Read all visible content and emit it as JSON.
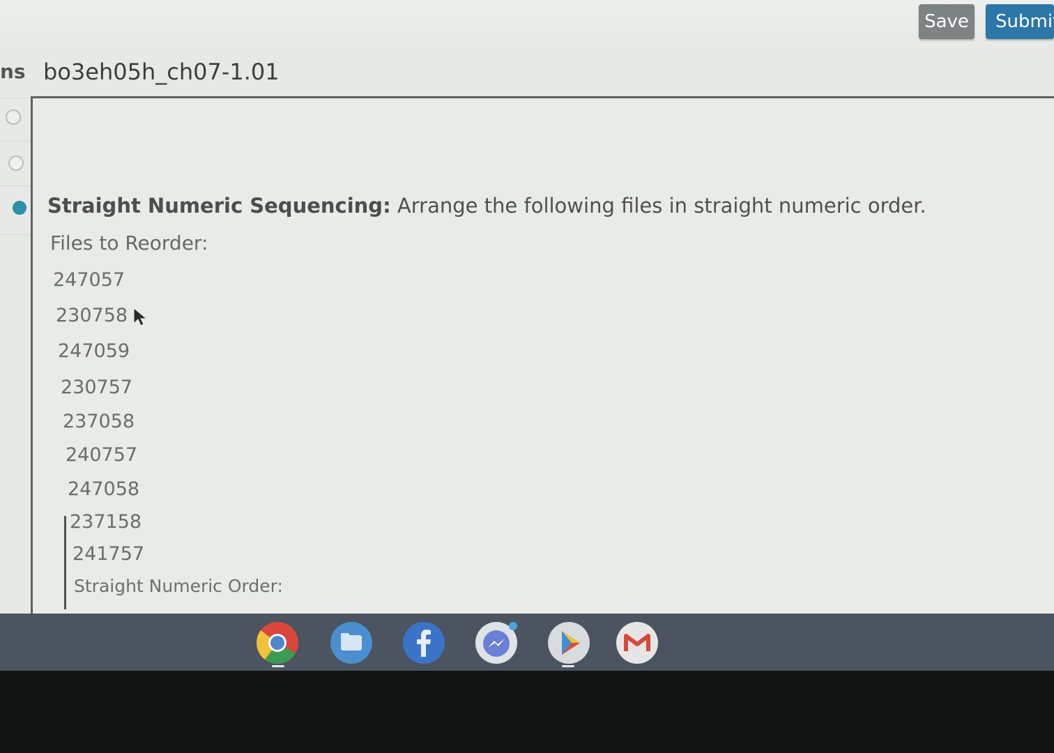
{
  "toolbar": {
    "save_label": "Save",
    "submit_label": "Submit"
  },
  "rail": {
    "cut_label": "ns"
  },
  "document": {
    "title": "bo3eh05h_ch07-1.01"
  },
  "question": {
    "heading": "Straight Numeric Sequencing:",
    "prompt": " Arrange the following files in straight numeric order.",
    "files_label": "Files to Reorder:",
    "files": [
      "247057",
      "230758",
      "247059",
      "230757",
      "237058",
      "240757",
      "247058",
      "237158",
      "241757"
    ],
    "order_label": "Straight Numeric Order:"
  },
  "shelf": {
    "apps": [
      "chrome-icon",
      "files-icon",
      "facebook-icon",
      "messenger-icon",
      "play-store-icon",
      "gmail-icon"
    ]
  },
  "colors": {
    "submit": "#2d76a8",
    "save": "#7d8282",
    "shelf": "#4b5460",
    "accent": "#2f8fa6"
  }
}
